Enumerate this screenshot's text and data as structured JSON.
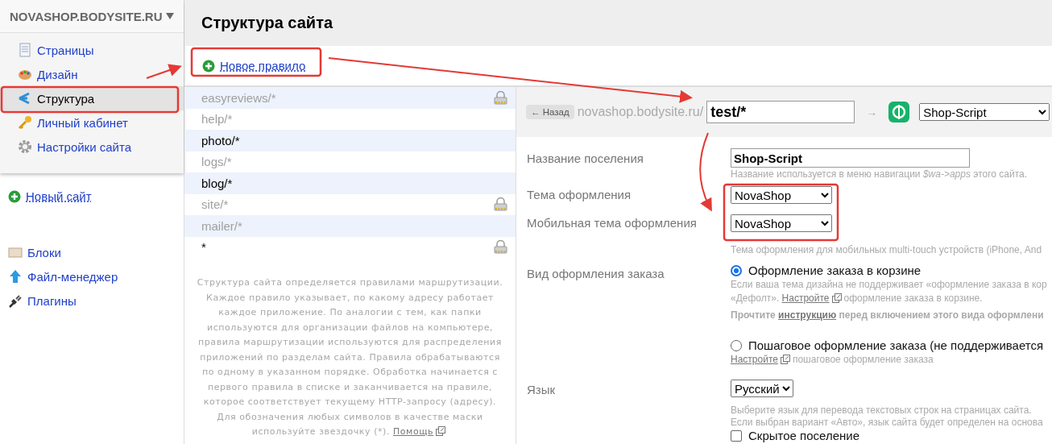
{
  "sidebar": {
    "site_title": "NOVASHOP.BODYSITE.RU",
    "menu": [
      {
        "label": "Страницы",
        "selected": false
      },
      {
        "label": "Дизайн",
        "selected": false
      },
      {
        "label": "Структура",
        "selected": true
      },
      {
        "label": "Личный кабинет",
        "selected": false
      },
      {
        "label": "Настройки сайта",
        "selected": false
      }
    ],
    "new_site": "Новый сайт",
    "tools": [
      {
        "label": "Блоки"
      },
      {
        "label": "Файл-менеджер"
      },
      {
        "label": "Плагины"
      }
    ]
  },
  "page": {
    "title": "Структура сайта",
    "new_rule": "Новое правило"
  },
  "routes": [
    {
      "url": "easyreviews/*",
      "disabled": true,
      "locked": true
    },
    {
      "url": "help/*",
      "disabled": true,
      "locked": false
    },
    {
      "url": "photo/*",
      "disabled": false,
      "locked": false
    },
    {
      "url": "logs/*",
      "disabled": true,
      "locked": false
    },
    {
      "url": "blog/*",
      "disabled": false,
      "locked": false
    },
    {
      "url": "site/*",
      "disabled": true,
      "locked": true
    },
    {
      "url": "mailer/*",
      "disabled": true,
      "locked": false
    },
    {
      "url": "*",
      "disabled": false,
      "locked": true
    }
  ],
  "help": {
    "text": "Структура сайта определяется правилами маршрутизации. Каждое правило указывает, по какому адресу работает каждое приложение. По аналогии с тем, как папки используются для организации файлов на компьютере, правила маршрутизации используются для распределения приложений по разделам сайта. Правила обрабатываются по одному в указанном порядке. Обработка начинается с первого правила в списке и заканчивается на правиле, которое соответствует текущему HTTP-запросу (адресу). Для обозначения любых символов в качестве маски используйте звездочку (*).",
    "link": "Помощь"
  },
  "editor": {
    "back_arrow": "←",
    "back": "Назад",
    "domain": "novashop.bodysite.ru/",
    "url": "test/*",
    "arrow": "→",
    "app": "Shop-Script"
  },
  "fields": [
    {
      "kind": "text",
      "label": "Название поселения",
      "value": "Shop-Script",
      "hints": [
        "Название используется в меню навигации *$wa->apps* этого сайта."
      ]
    },
    {
      "kind": "select",
      "label": "Тема оформления",
      "value": "NovaShop"
    },
    {
      "kind": "select",
      "label": "Мобильная тема оформления",
      "value": "NovaShop",
      "hints": [
        "Тема оформления для мобильных multi-touch устройств (iPhone, And"
      ]
    },
    {
      "kind": "radio",
      "label": "Вид оформления заказа",
      "options": [
        {
          "label": "Оформление заказа в корзине",
          "selected": true,
          "hint": "Если ваша тема дизайна не поддерживает «оформление заказа в кор",
          "setup_before": "«Дефолт».",
          "setup_link": "Настройте",
          "setup_after": "оформление заказа в корзине.",
          "note_before": "Прочтите",
          "note_link": "инструкцию",
          "note_after": "перед включением этого вида оформлени"
        },
        {
          "label": "Пошаговое оформление заказа (не поддерживается",
          "selected": false,
          "setup_link": "Настройте",
          "setup_after": "пошаговое оформление заказа"
        }
      ]
    },
    {
      "kind": "select",
      "label": "Язык",
      "value": "Русский",
      "hints": [
        "Выберите язык для перевода текстовых строк на страницах сайта.",
        "Если выбран вариант «Авто», язык сайта будет определен на основа"
      ]
    },
    {
      "kind": "checkbox",
      "label": "Скрытое поселение",
      "checked": false
    }
  ]
}
